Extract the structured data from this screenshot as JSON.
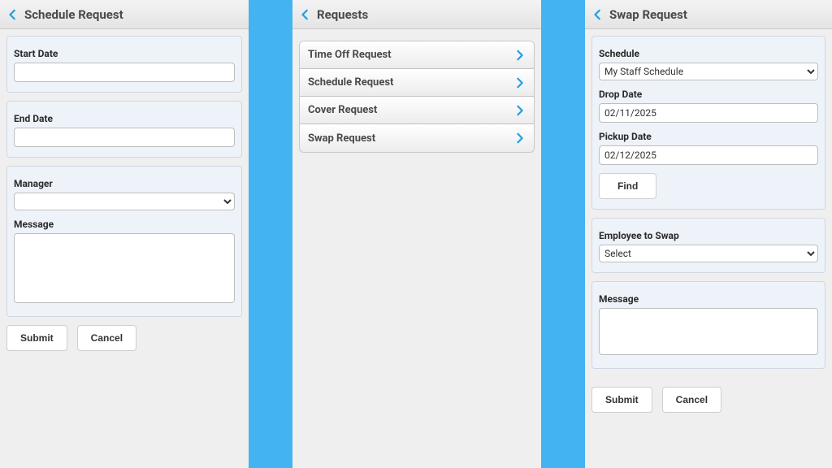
{
  "left": {
    "title": "Schedule Request",
    "start_date_label": "Start Date",
    "start_date_value": "",
    "end_date_label": "End Date",
    "end_date_value": "",
    "manager_label": "Manager",
    "manager_value": "",
    "message_label": "Message",
    "message_value": "",
    "submit": "Submit",
    "cancel": "Cancel"
  },
  "mid": {
    "title": "Requests",
    "items": [
      {
        "label": "Time Off Request"
      },
      {
        "label": "Schedule Request"
      },
      {
        "label": "Cover Request"
      },
      {
        "label": "Swap Request"
      }
    ]
  },
  "right": {
    "title": "Swap Request",
    "schedule_label": "Schedule",
    "schedule_value": "My Staff Schedule",
    "drop_label": "Drop Date",
    "drop_value": "02/11/2025",
    "pickup_label": "Pickup Date",
    "pickup_value": "02/12/2025",
    "find": "Find",
    "employee_label": "Employee to Swap",
    "employee_value": "Select",
    "message_label": "Message",
    "message_value": "",
    "submit": "Submit",
    "cancel": "Cancel"
  }
}
